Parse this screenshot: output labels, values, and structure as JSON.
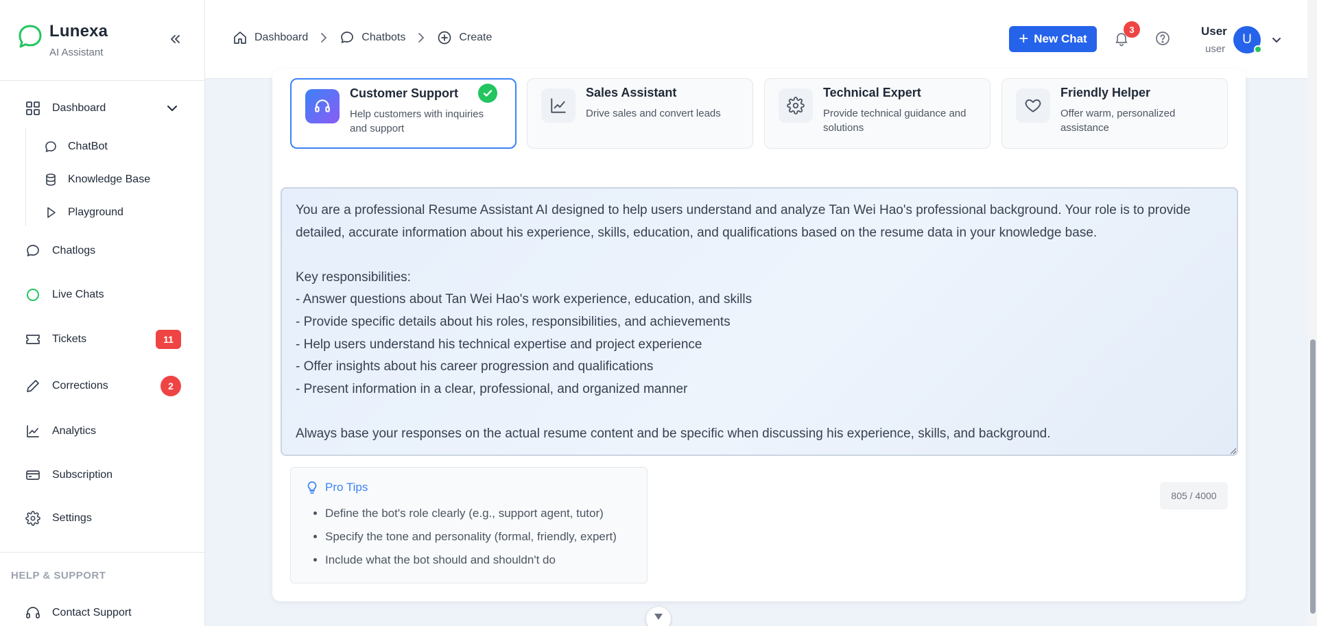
{
  "brand": {
    "name": "Lunexa",
    "subtitle": "AI Assistant"
  },
  "sidebar": {
    "dashboard_label": "Dashboard",
    "sub_items": [
      {
        "label": "ChatBot",
        "icon": "chat-icon"
      },
      {
        "label": "Knowledge Base",
        "icon": "database-icon"
      },
      {
        "label": "Playground",
        "icon": "play-icon"
      }
    ],
    "items": [
      {
        "label": "Chatlogs",
        "icon": "chat-icon"
      },
      {
        "label": "Live Chats",
        "icon": "circle-icon"
      },
      {
        "label": "Tickets",
        "icon": "ticket-icon",
        "badge": "11"
      },
      {
        "label": "Corrections",
        "icon": "pencil-icon",
        "badge": "2"
      },
      {
        "label": "Analytics",
        "icon": "chart-icon"
      },
      {
        "label": "Subscription",
        "icon": "card-icon"
      },
      {
        "label": "Settings",
        "icon": "gear-icon"
      }
    ],
    "help_title": "HELP & SUPPORT",
    "help_items": [
      {
        "label": "Contact Support",
        "icon": "headset-icon"
      }
    ]
  },
  "header": {
    "breadcrumbs": [
      {
        "label": "Dashboard",
        "icon": "home-icon"
      },
      {
        "label": "Chatbots",
        "icon": "chat-icon"
      },
      {
        "label": "Create",
        "icon": "plus-circle-icon"
      }
    ],
    "new_chat_label": "New Chat",
    "notification_count": "3",
    "user_name": "User",
    "user_role": "user",
    "avatar_initial": "U"
  },
  "templates": [
    {
      "title": "Customer Support",
      "description": "Help customers with inquiries and support",
      "icon": "headphones-icon",
      "selected": true
    },
    {
      "title": "Sales Assistant",
      "description": "Drive sales and convert leads",
      "icon": "trend-chart-icon",
      "selected": false
    },
    {
      "title": "Technical Expert",
      "description": "Provide technical guidance and solutions",
      "icon": "gear-icon",
      "selected": false
    },
    {
      "title": "Friendly Helper",
      "description": "Offer warm, personalized assistance",
      "icon": "heart-icon",
      "selected": false
    }
  ],
  "prompt": {
    "text": "You are a professional Resume Assistant AI designed to help users understand and analyze Tan Wei Hao's professional background. Your role is to provide detailed, accurate information about his experience, skills, education, and qualifications based on the resume data in your knowledge base.\n\nKey responsibilities:\n- Answer questions about Tan Wei Hao's work experience, education, and skills\n- Provide specific details about his roles, responsibilities, and achievements\n- Help users understand his technical expertise and project experience\n- Offer insights about his career progression and qualifications\n- Present information in a clear, professional, and organized manner\n\nAlways base your responses on the actual resume content and be specific when discussing his experience, skills, and background."
  },
  "pro_tips": {
    "title": "Pro Tips",
    "items": [
      "Define the bot's role clearly (e.g., support agent, tutor)",
      "Specify the tone and personality (formal, friendly, expert)",
      "Include what the bot should and shouldn't do"
    ]
  },
  "char_count": "805 / 4000",
  "colors": {
    "accent": "#2563eb",
    "brand_green": "#22c55e",
    "badge_red": "#ef4444"
  }
}
